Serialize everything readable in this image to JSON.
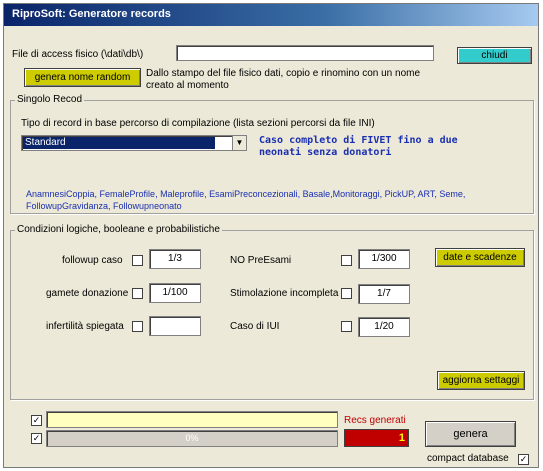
{
  "window": {
    "title": "RiproSoft: Generatore records"
  },
  "file_section": {
    "file_label": "File di access fisico (\\dati\\db\\)",
    "file_value": "",
    "close_label": "chiudi",
    "random_label": "genera nome random",
    "description": "Dallo stampo del file fisico dati, copio e rinomino con un nome creato al momento"
  },
  "single_record": {
    "group_title": "Singolo Recod",
    "type_label": "Tipo di record in base percorso di compilazione (lista sezioni percorsi da file INI)",
    "selected_type": "Standard",
    "case_description": "Caso completo di FIVET fino a due neonati senza donatori",
    "sections_list": "AnamnesiCoppia, FemaleProfile, Maleprofile, EsamiPreconcezionali, Basale,Monitoraggi, PickUP, ART, Seme, FollowupGravidanza, Followupneonato"
  },
  "conditions": {
    "group_title": "Condizioni logiche, booleane e probabilistiche",
    "followup_label": "followup caso",
    "followup_value": "1/3",
    "gamete_label": "gamete donazione",
    "gamete_value": "1/100",
    "infert_label": "infertilità spiegata",
    "infert_value": "",
    "nopre_label": "NO PreEsami",
    "nopre_value": "1/300",
    "stim_label": "Stimolazione incompleta",
    "stim_value": "1/7",
    "iui_label": "Caso di IUI",
    "iui_value": "1/20",
    "dates_button": "date e scadenze",
    "update_button": "aggiorna settaggi"
  },
  "footer": {
    "progress_text": "0%",
    "progress_percent": 0,
    "recs_label": "Recs generati",
    "recs_value": "1",
    "generate_label": "genera",
    "compact_label": "compact database",
    "check_mark": "✓"
  },
  "colors": {
    "yellow_field": "#ffffc0",
    "red_counter": "#c00000",
    "teal_button": "#33cccc",
    "yellow_button": "#cccc00"
  }
}
